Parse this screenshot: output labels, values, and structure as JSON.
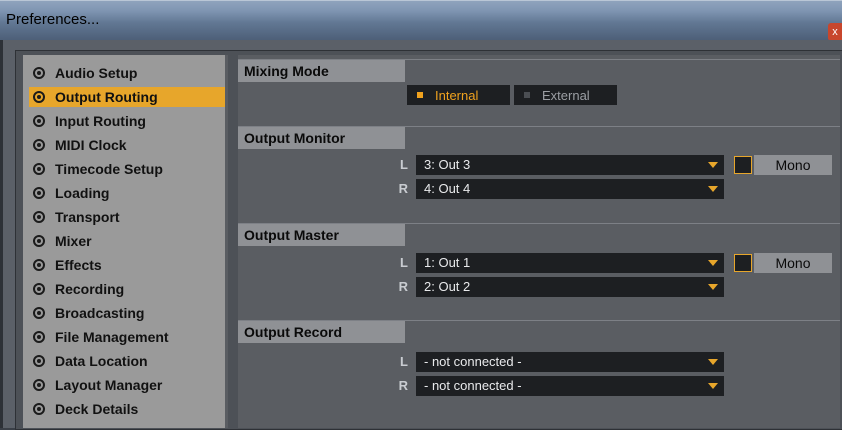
{
  "window": {
    "title": "Preferences...",
    "close_glyph": "x"
  },
  "sidebar": {
    "items": [
      {
        "label": "Audio Setup"
      },
      {
        "label": "Output Routing"
      },
      {
        "label": "Input Routing"
      },
      {
        "label": "MIDI Clock"
      },
      {
        "label": "Timecode Setup"
      },
      {
        "label": "Loading"
      },
      {
        "label": "Transport"
      },
      {
        "label": "Mixer"
      },
      {
        "label": "Effects"
      },
      {
        "label": "Recording"
      },
      {
        "label": "Broadcasting"
      },
      {
        "label": "File Management"
      },
      {
        "label": "Data Location"
      },
      {
        "label": "Layout Manager"
      },
      {
        "label": "Deck Details"
      }
    ],
    "active_index": 1
  },
  "mixing_mode": {
    "label": "Mixing Mode",
    "options": [
      "Internal",
      "External"
    ],
    "selected": "Internal"
  },
  "output_monitor": {
    "label": "Output Monitor",
    "left_label": "L",
    "right_label": "R",
    "left_value": "3: Out 3",
    "right_value": "4: Out 4",
    "mono_label": "Mono",
    "mono_checked": false
  },
  "output_master": {
    "label": "Output Master",
    "left_label": "L",
    "right_label": "R",
    "left_value": "1: Out 1",
    "right_value": "2: Out 2",
    "mono_label": "Mono",
    "mono_checked": false
  },
  "output_record": {
    "label": "Output Record",
    "left_label": "L",
    "right_label": "R",
    "left_value": "- not connected -",
    "right_value": "- not connected -"
  },
  "colors": {
    "accent": "#e7a62b",
    "panel": "#5a5d62",
    "sidebar": "#9a9a9a",
    "control": "#1d1f22"
  }
}
